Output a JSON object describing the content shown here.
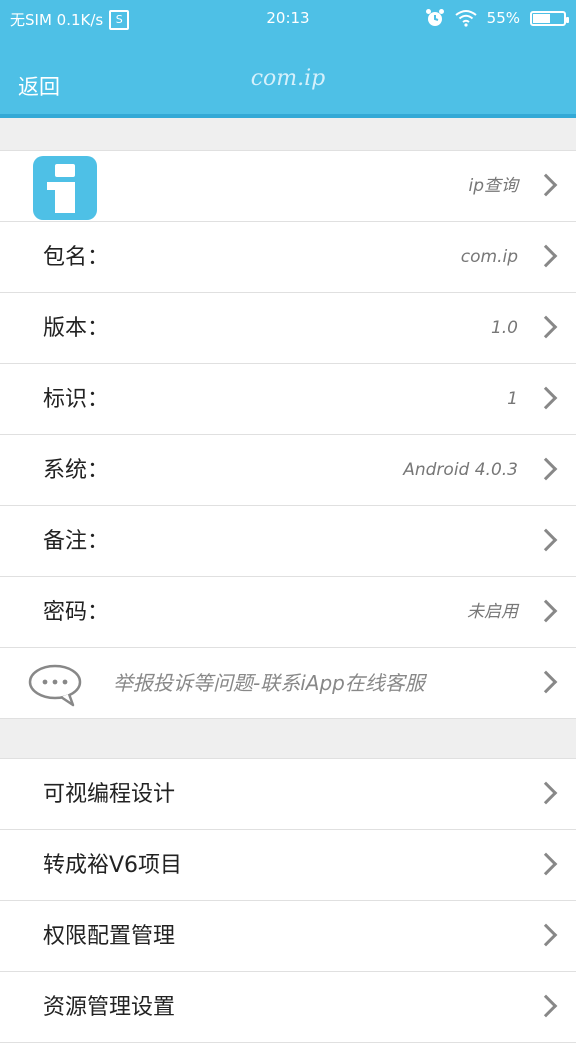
{
  "status_bar": {
    "carrier": "无SIM 0.1K/s",
    "sim_badge": "S",
    "time": "20:13",
    "battery_level": "55%",
    "battery_fraction": 0.55
  },
  "nav": {
    "back_label": "返回",
    "title": "com.ip"
  },
  "app_row": {
    "name": "ip查询"
  },
  "info_rows": [
    {
      "label": "包名：",
      "value": "com.ip"
    },
    {
      "label": "版本：",
      "value": "1.0"
    },
    {
      "label": "标识：",
      "value": "1"
    },
    {
      "label": "系统：",
      "value": "Android 4.0.3"
    },
    {
      "label": "备注：",
      "value": ""
    },
    {
      "label": "密码：",
      "value": "未启用"
    }
  ],
  "report_row": {
    "text": "举报投诉等问题-联系iApp在线客服"
  },
  "actions": [
    {
      "label": "可视编程设计"
    },
    {
      "label": "转成裕V6项目"
    },
    {
      "label": "权限配置管理"
    },
    {
      "label": "资源管理设置"
    }
  ],
  "colors": {
    "header": "#4ec0e6",
    "header_border": "#33a9d6",
    "background": "#efefef"
  }
}
